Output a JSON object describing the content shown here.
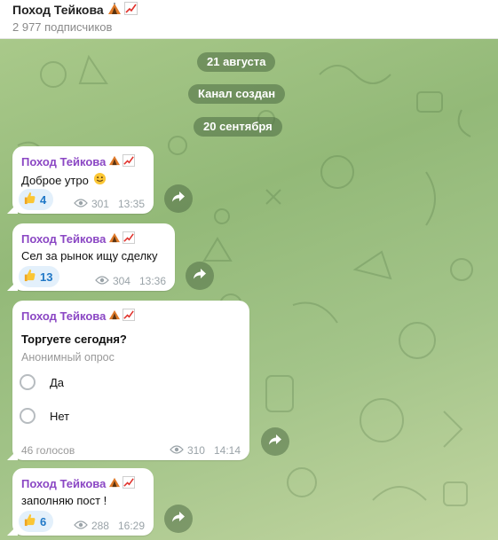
{
  "channel": {
    "title": "Поход Тейкова",
    "subscribers": "2 977 подписчиков"
  },
  "service": {
    "date1": "21 августа",
    "created": "Канал создан",
    "date2": "20 сентября"
  },
  "messages": [
    {
      "sender": "Поход Тейкова",
      "text": "Доброе утро",
      "reaction_count": "4",
      "views": "301",
      "time": "13:35"
    },
    {
      "sender": "Поход Тейкова",
      "text": "Сел за рынок ищу сделку",
      "reaction_count": "13",
      "views": "304",
      "time": "13:36"
    },
    {
      "sender": "Поход Тейкова",
      "question": "Торгуете сегодня?",
      "poll_type": "Анонимный опрос",
      "options": [
        "Да",
        "Нет"
      ],
      "votes": "46 голосов",
      "views": "310",
      "time": "14:14"
    },
    {
      "sender": "Поход Тейкова",
      "text": "заполняю пост !",
      "reaction_count": "6",
      "views": "288",
      "time": "16:29"
    }
  ],
  "icons": {
    "title_emoji": [
      "tent-icon",
      "chart-increasing-icon"
    ],
    "reaction": "thumbs-up-icon",
    "views": "eye-icon",
    "forward": "forward-arrow-icon",
    "smile": "smiling-face-icon"
  },
  "colors": {
    "sender": "#8b47c4",
    "reaction_text": "#1f77c6",
    "reaction_bg": "#e3f0fb",
    "service_pill": "#4b6941"
  }
}
